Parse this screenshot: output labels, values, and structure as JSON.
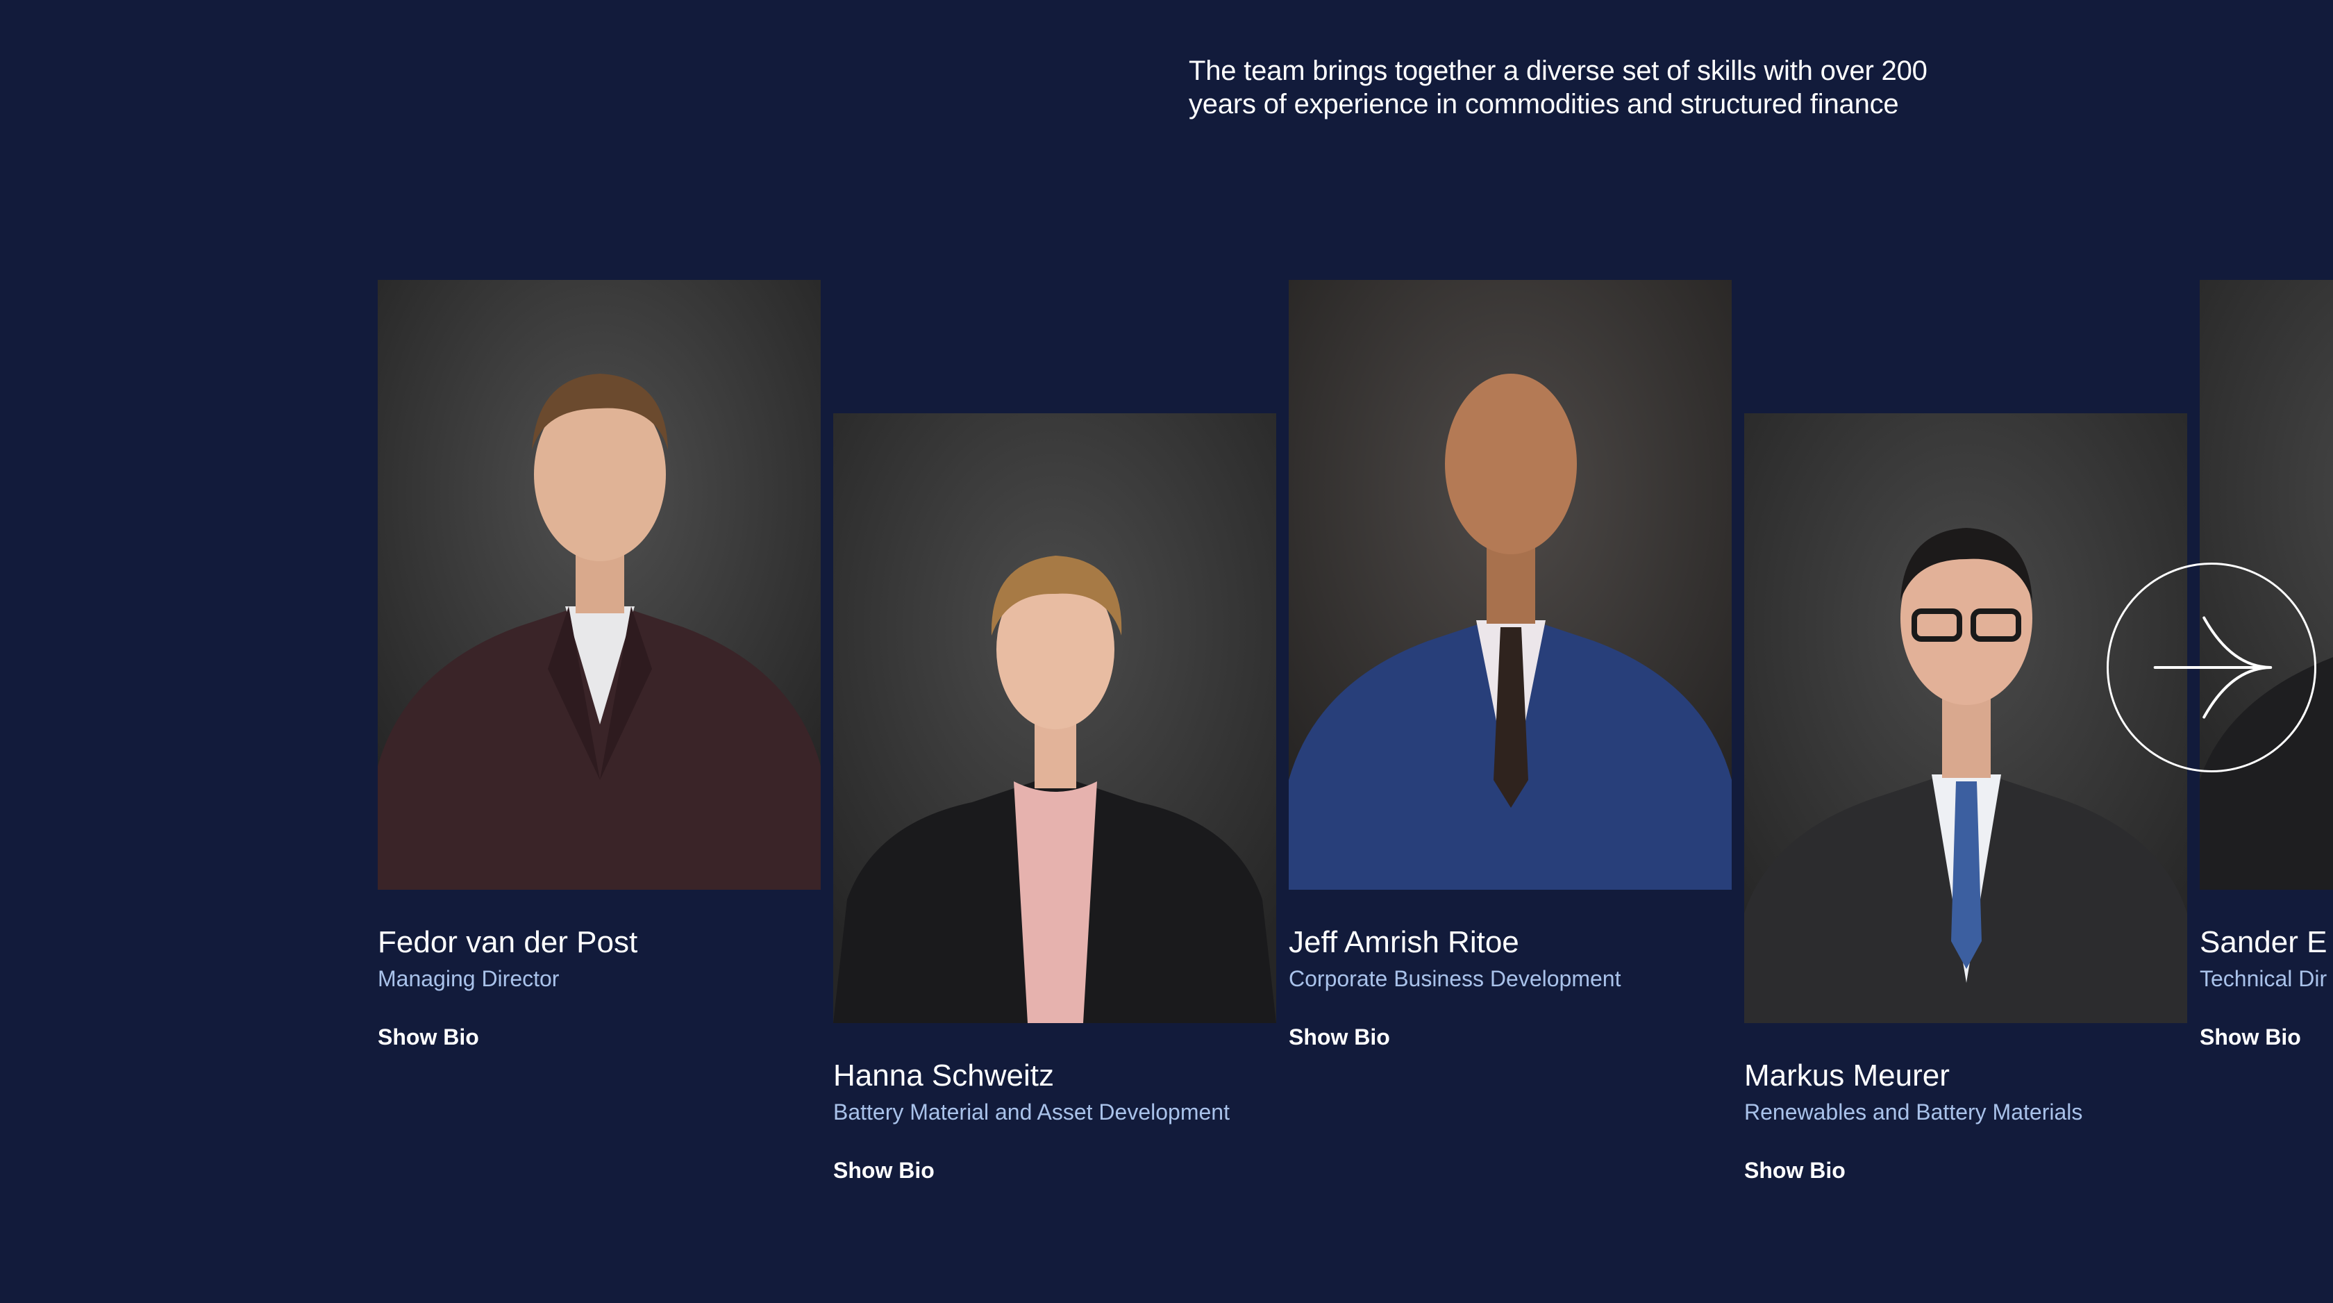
{
  "intro": {
    "text": "The team brings together a diverse set of skills with over 200 years of experience in commodities and structured finance"
  },
  "team": [
    {
      "name": "Fedor van der Post",
      "role": "Managing Director",
      "bio_label": "Show Bio"
    },
    {
      "name": "Hanna Schweitz",
      "role": "Battery Material and Asset Development",
      "bio_label": "Show Bio"
    },
    {
      "name": "Jeff Amrish Ritoe",
      "role": "Corporate Business Development",
      "bio_label": "Show Bio"
    },
    {
      "name": "Markus Meurer",
      "role": "Renewables and Battery Materials",
      "bio_label": "Show Bio"
    },
    {
      "name": "Sander E",
      "role": "Technical Dir",
      "bio_label": "Show Bio"
    }
  ],
  "carousel": {
    "next_icon": "arrow-right-icon"
  },
  "colors": {
    "background": "#121b3b",
    "text": "#ffffff",
    "role_text": "#a9c2ea"
  }
}
